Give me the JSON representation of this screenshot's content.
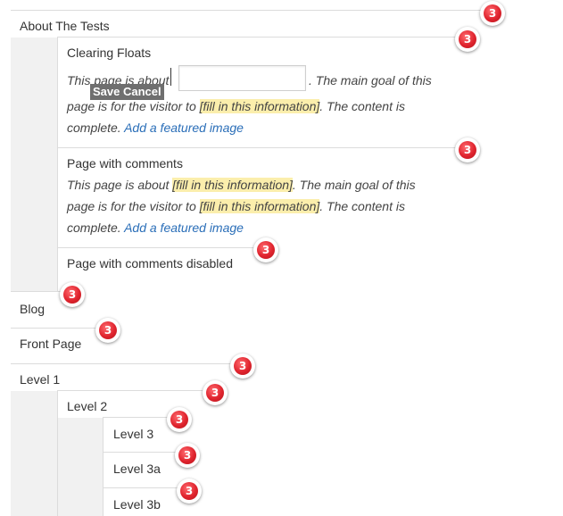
{
  "badge_count": "3",
  "pages": {
    "about": {
      "title": "About The Tests"
    },
    "clearing_floats": {
      "title": "Clearing Floats",
      "desc_start": "This page is about",
      "desc_mid": ". The main goal of this",
      "line2_start": "page is for the visitor to",
      "placeholder_text": "[fill in this information]",
      "desc_end": ". The content is",
      "line3_start": "complete.",
      "link": "Add a featured image"
    },
    "comments": {
      "title": "Page with comments",
      "desc_start": "This page is about",
      "placeholder_1": "[fill in this information]",
      "desc_mid": ". The main goal of this",
      "line2_start": "page is for the visitor to",
      "placeholder_2": "[fill in this information]",
      "desc_end": ". The content is",
      "line3_start": "complete.",
      "link": "Add a featured image"
    },
    "comments_disabled": {
      "title": "Page with comments disabled"
    },
    "blog": {
      "title": "Blog"
    },
    "front_page": {
      "title": "Front Page"
    },
    "level1": {
      "title": "Level 1"
    },
    "level2": {
      "title": "Level 2"
    },
    "level3": {
      "title": "Level 3"
    },
    "level3a": {
      "title": "Level 3a"
    },
    "level3b": {
      "title": "Level 3b"
    }
  },
  "inline_editor": {
    "input_value": "",
    "save_label": "Save",
    "cancel_label": "Cancel"
  }
}
